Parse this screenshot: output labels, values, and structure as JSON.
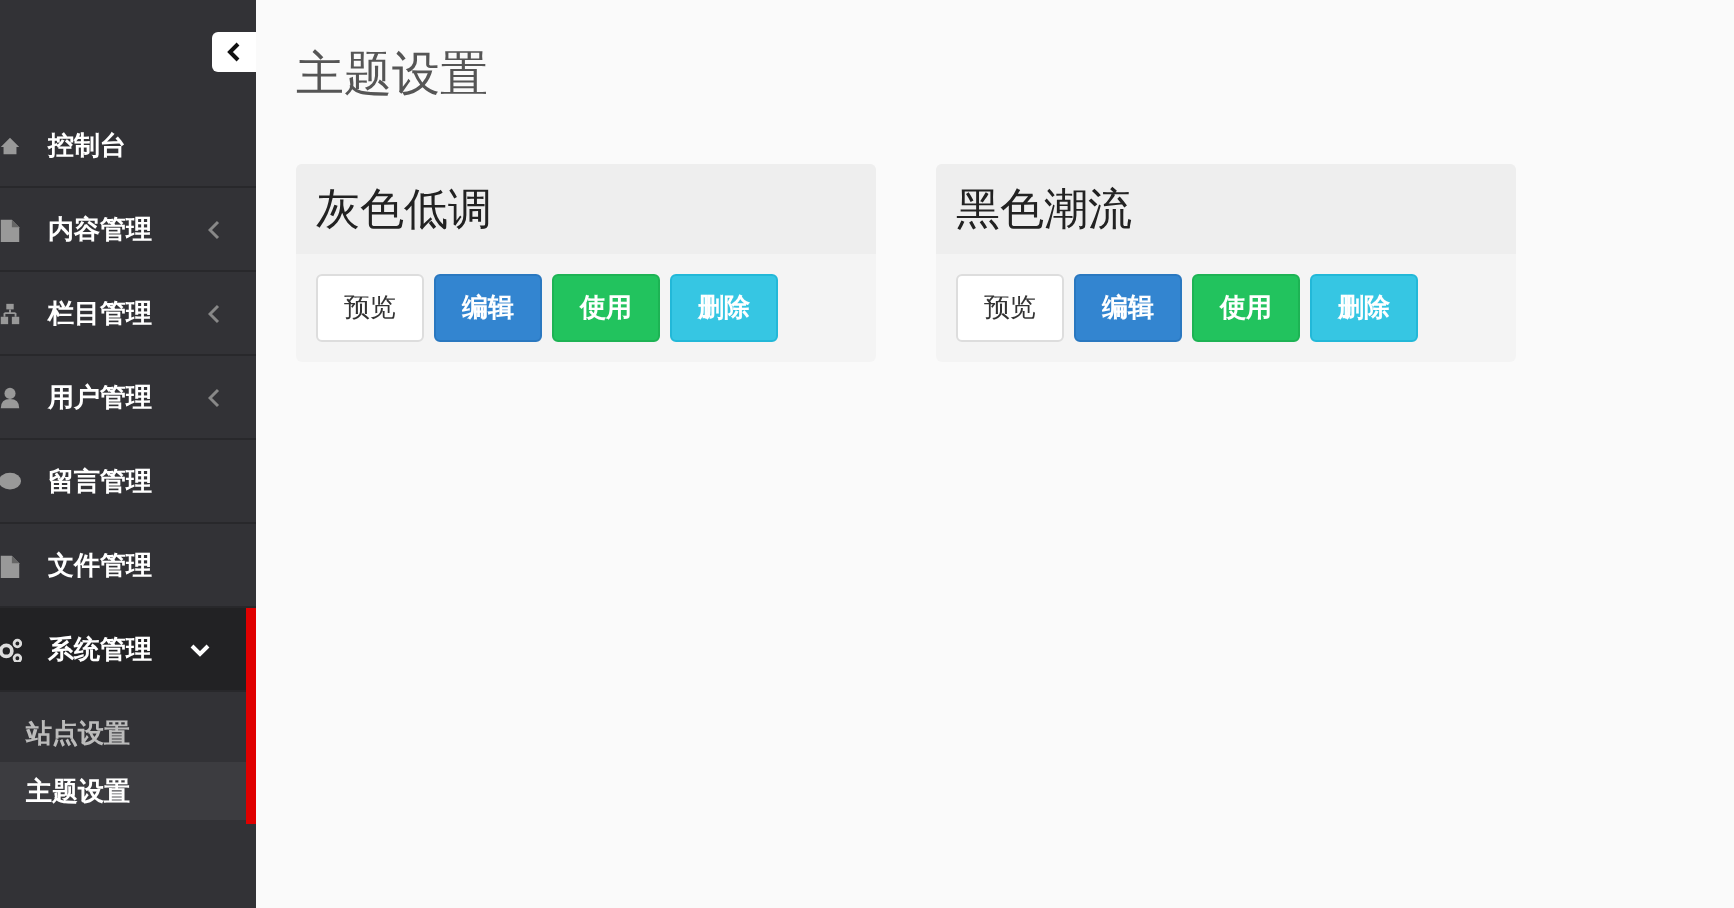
{
  "sidebar": {
    "items": [
      {
        "label": "控制台",
        "selected": false
      },
      {
        "label": "内容管理",
        "selected": false,
        "expanded": false
      },
      {
        "label": "栏目管理",
        "selected": false,
        "expanded": false
      },
      {
        "label": "用户管理",
        "selected": false,
        "expanded": false
      },
      {
        "label": "留言管理",
        "selected": false
      },
      {
        "label": "文件管理",
        "selected": false
      },
      {
        "label": "系统管理",
        "selected": true,
        "expanded": true,
        "children": [
          {
            "label": "站点设置",
            "selected": false
          },
          {
            "label": "主题设置",
            "selected": true
          }
        ]
      }
    ]
  },
  "page_title": "主题设置",
  "themes": [
    {
      "name": "灰色低调",
      "buttons": [
        {
          "label": "预览",
          "kind": "default"
        },
        {
          "label": "编辑",
          "kind": "primary"
        },
        {
          "label": "使用",
          "kind": "success"
        },
        {
          "label": "删除",
          "kind": "info"
        }
      ]
    },
    {
      "name": "黑色潮流",
      "buttons": [
        {
          "label": "预览",
          "kind": "default"
        },
        {
          "label": "编辑",
          "kind": "primary"
        },
        {
          "label": "使用",
          "kind": "success"
        },
        {
          "label": "删除",
          "kind": "info"
        }
      ]
    }
  ]
}
